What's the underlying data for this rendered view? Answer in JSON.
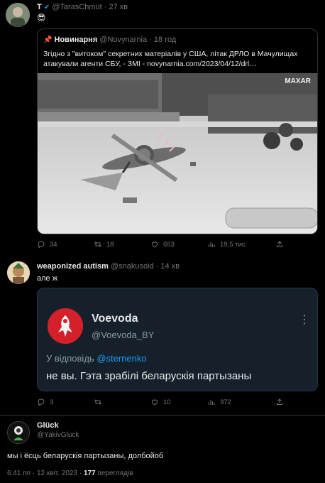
{
  "tweet1": {
    "author_name": "T",
    "author_handle": "@TarasChmut",
    "separator": "·",
    "time": "27 хв",
    "emoji": "😎",
    "quote": {
      "author_name": "Новинарня",
      "author_handle": "@Novynarnia",
      "time": "18 год",
      "text": "Згідно з \"витоком\" секретних матеріалів у США, літак ДРЛО в Мачулищах атакували агенти СБУ, - ЗМІ - novynarnia.com/2023/04/12/drl…",
      "watermark": "MAXAR"
    },
    "actions": {
      "replies": "34",
      "retweets": "18",
      "likes": "653",
      "views": "19,5 тис."
    }
  },
  "tweet2": {
    "author_name": "weaponized autism",
    "author_handle": "@snakusoid",
    "separator": "·",
    "time": "14 хв",
    "text": "але ж",
    "embed": {
      "author_name": "Voevoda",
      "author_handle": "@Voevoda_BY",
      "more": "⋮",
      "reply_prefix": "У відповідь",
      "reply_mention": "@sternenko",
      "text": "не вы. Гэта зрабілі беларускія партызаны"
    },
    "actions": {
      "replies": "3",
      "retweets": "",
      "likes": "10",
      "views": "372"
    }
  },
  "tweet3": {
    "author_name": "Glück",
    "author_handle": "@YakivGluck",
    "text": "мы і ёсць беларускія партызаны, долбойоб",
    "timestamp": "6:41 пп · 12 квіт. 2023 ·",
    "views": "177",
    "views_label": "переглядів"
  },
  "colors": {
    "background": "#000000",
    "accent": "#1d9bf0",
    "muted": "#71767b",
    "text": "#e7e9ea"
  },
  "icons": [
    "reply-icon",
    "retweet-icon",
    "like-icon",
    "views-icon",
    "share-icon"
  ]
}
